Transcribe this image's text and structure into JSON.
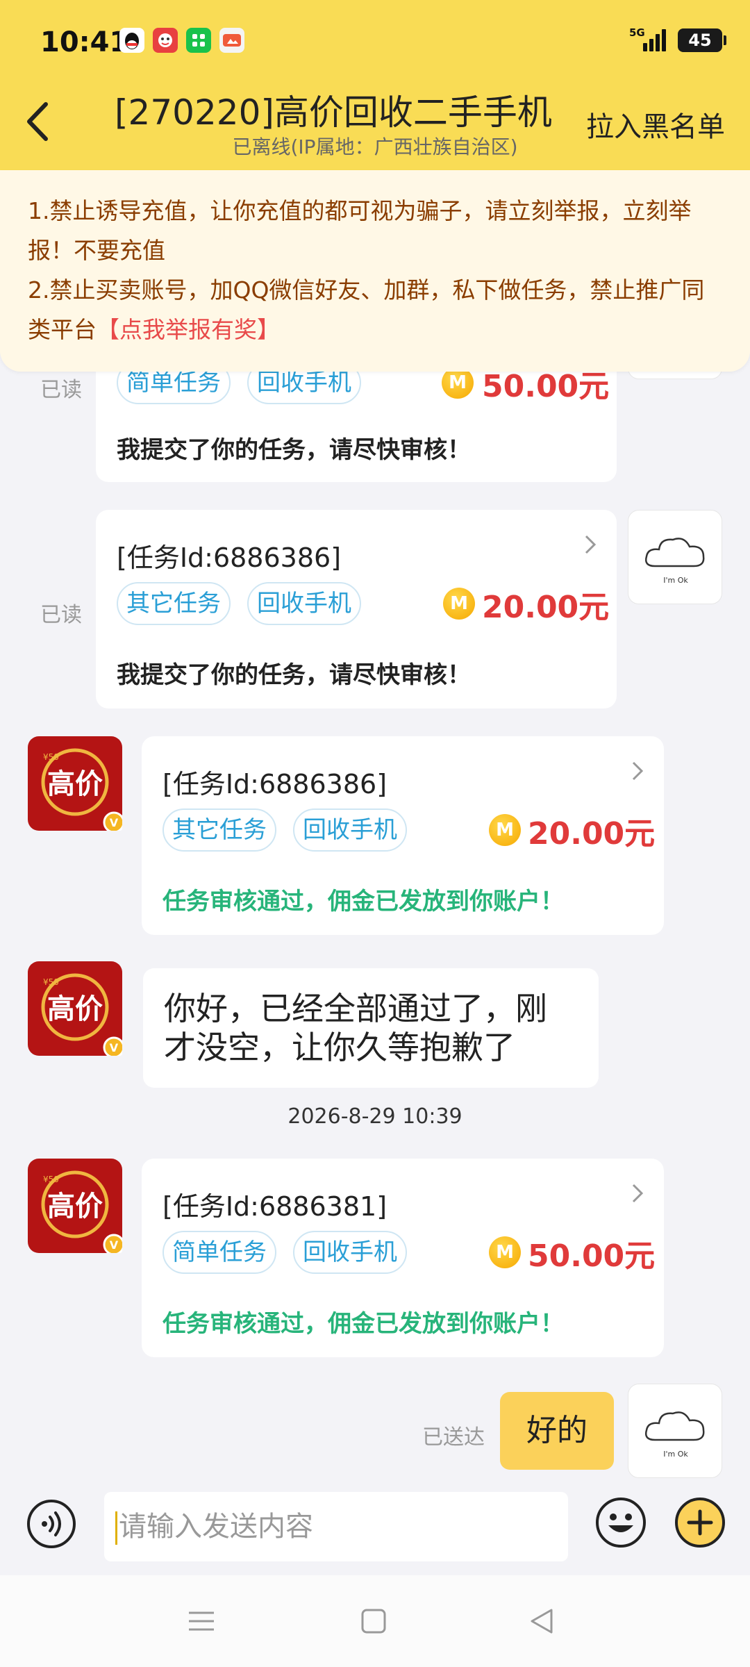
{
  "status_bar": {
    "time": "10:41",
    "network": "5G",
    "battery": "45"
  },
  "header": {
    "title": "[270220]高价回收二手手机",
    "subtitle": "已离线(IP属地：广西壮族自治区)",
    "blacklist_label": "拉入黑名单"
  },
  "notice": {
    "line1": "1.禁止诱导充值，让你充值的都可视为骗子，请立刻举报，立刻举报！不要充值",
    "line2": "2.禁止买卖账号，加QQ微信好友、加群，私下做任务，禁止推广同类平台",
    "report_link": "【点我举报有奖】"
  },
  "messages": [
    {
      "read": "已读",
      "tags": [
        "简单任务",
        "回收手机"
      ],
      "amount": "50.00元",
      "note": "我提交了你的任务，请尽快审核！"
    },
    {
      "read": "已读",
      "task_id": "[任务Id:6886386]",
      "tags": [
        "其它任务",
        "回收手机"
      ],
      "amount": "20.00元",
      "note": "我提交了你的任务，请尽快审核！"
    },
    {
      "task_id": "[任务Id:6886386]",
      "tags": [
        "其它任务",
        "回收手机"
      ],
      "amount": "20.00元",
      "note": "任务审核通过，佣金已发放到你账户！"
    },
    {
      "text": "你好，已经全部通过了，刚才没空，让你久等抱歉了"
    },
    {
      "timestamp": "2026-8-29 10:39"
    },
    {
      "task_id": "[任务Id:6886381]",
      "tags": [
        "简单任务",
        "回收手机"
      ],
      "amount": "50.00元",
      "note": "任务审核通过，佣金已发放到你账户！"
    },
    {
      "status": "已送达",
      "text": "好的"
    }
  ],
  "brand_avatar_text": "高价",
  "brand_avatar_badge": "¥50",
  "cloud_avatar_text": "I'm Ok",
  "coin_symbol": "M",
  "input": {
    "placeholder": "请输入发送内容"
  }
}
